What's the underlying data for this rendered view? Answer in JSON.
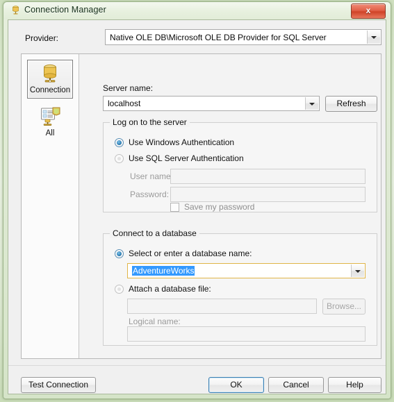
{
  "window": {
    "title": "Connection Manager",
    "icon": "database-cylinder-icon",
    "close_label": "x"
  },
  "provider": {
    "label": "Provider:",
    "value": "Native OLE DB\\Microsoft OLE DB Provider for SQL Server"
  },
  "sidebar": {
    "items": [
      {
        "label": "Connection",
        "icon": "database-cylinder-icon",
        "selected": true
      },
      {
        "label": "All",
        "icon": "properties-list-icon",
        "selected": false
      }
    ]
  },
  "server": {
    "name_label": "Server name:",
    "name_value": "localhost",
    "refresh_label": "Refresh"
  },
  "logon": {
    "group_title": "Log on to the server",
    "windows_auth_label": "Use Windows Authentication",
    "sql_auth_label": "Use SQL Server Authentication",
    "username_label": "User name:",
    "username_value": "",
    "password_label": "Password:",
    "password_value": "",
    "save_password_label": "Save my password"
  },
  "database": {
    "group_title": "Connect to a database",
    "select_label": "Select or enter a database name:",
    "select_value": "AdventureWorks",
    "attach_label": "Attach a database file:",
    "attach_value": "",
    "browse_label": "Browse...",
    "logical_name_label": "Logical name:",
    "logical_name_value": ""
  },
  "footer": {
    "test_connection_label": "Test Connection",
    "ok_label": "OK",
    "cancel_label": "Cancel",
    "help_label": "Help"
  },
  "colors": {
    "accent": "#3399ff",
    "default_button_border": "#3c7fb1",
    "close_button": "#cf4328",
    "window_frame": "#cfe0bf"
  }
}
